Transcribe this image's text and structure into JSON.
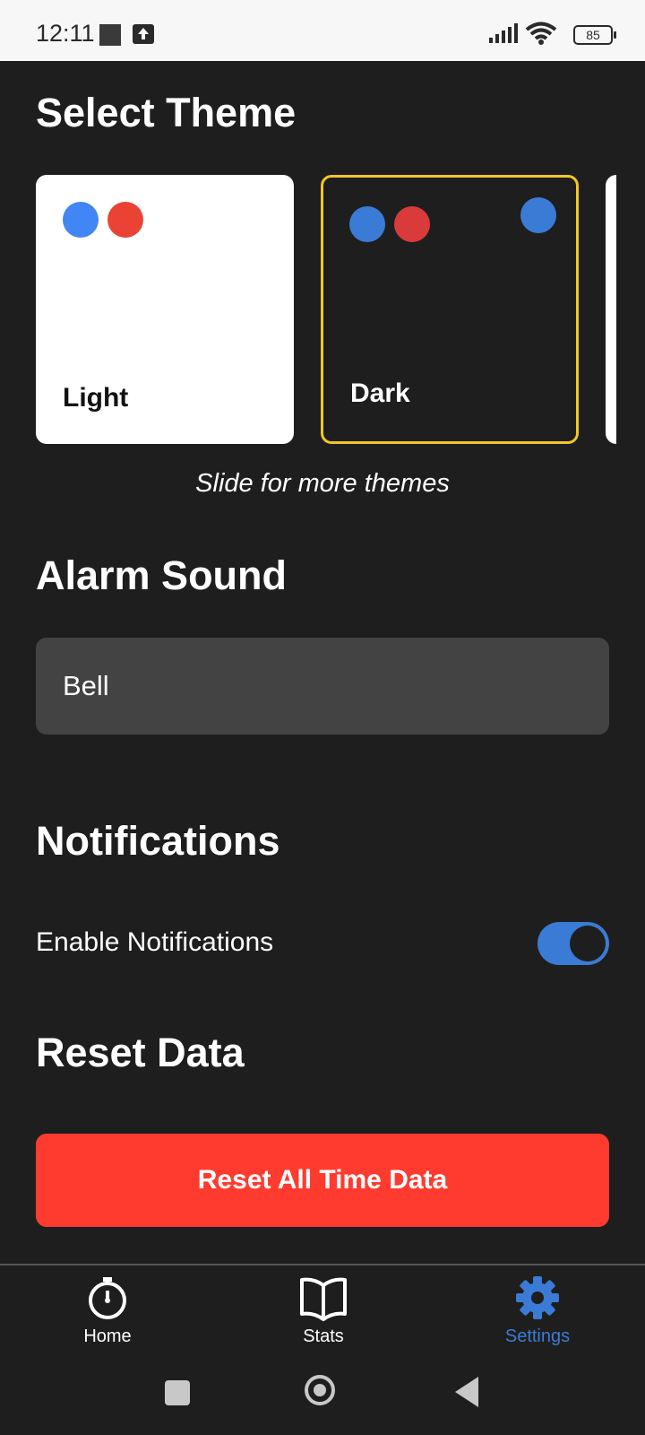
{
  "status_bar": {
    "time": "12:11",
    "battery": "85"
  },
  "sections": {
    "theme_title": "Select Theme",
    "alarm_title": "Alarm Sound",
    "notifications_title": "Notifications",
    "reset_title": "Reset Data"
  },
  "themes": [
    {
      "name": "Light",
      "colors": [
        "#4285f4",
        "#ea4335"
      ]
    },
    {
      "name": "Dark",
      "colors": [
        "#3a7bd5",
        "#d93a3a"
      ],
      "selected": true,
      "selected_dot_color": "#3a7bd5"
    }
  ],
  "theme_hint": "Slide for more themes",
  "alarm": {
    "selected": "Bell"
  },
  "notifications": {
    "label": "Enable Notifications",
    "enabled": true
  },
  "reset": {
    "button_label": "Reset All Time Data"
  },
  "nav": {
    "items": [
      {
        "label": "Home",
        "icon": "stopwatch-icon"
      },
      {
        "label": "Stats",
        "icon": "book-icon"
      },
      {
        "label": "Settings",
        "icon": "gear-icon",
        "active": true
      }
    ]
  },
  "colors": {
    "accent": "#3a7bd5",
    "danger": "#ff3b30",
    "selected_border": "#f3c623",
    "background": "#1e1e1e"
  }
}
